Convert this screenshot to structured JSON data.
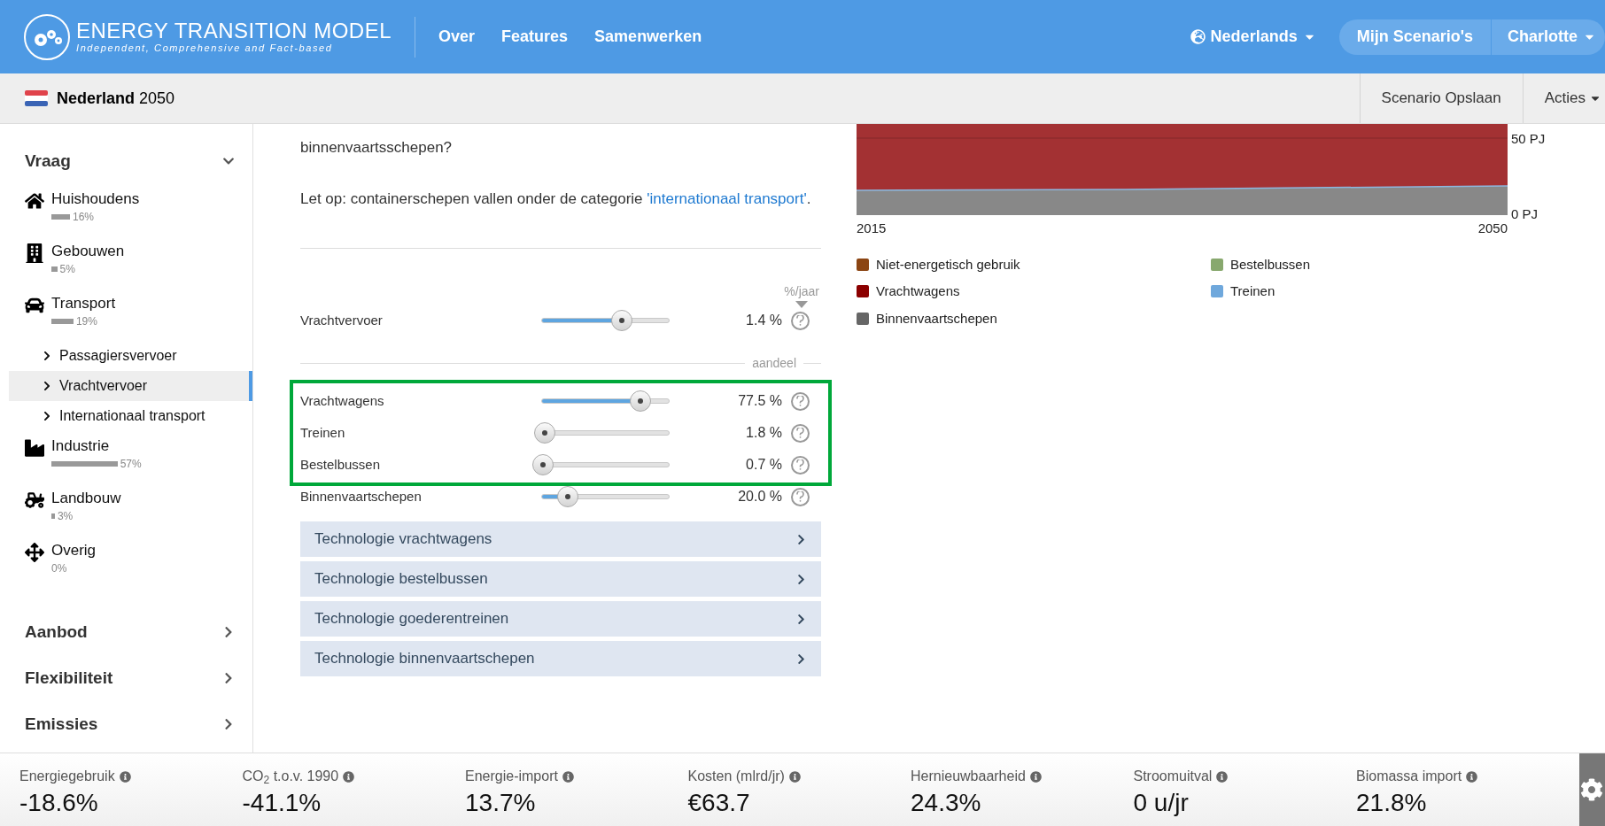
{
  "header": {
    "logo_title": "ENERGY TRANSITION MODEL",
    "logo_tagline": "Independent, Comprehensive and Fact-based",
    "nav": [
      "Over",
      "Features",
      "Samenwerken"
    ],
    "language": "Nederlands",
    "my_scenarios": "Mijn Scenario's",
    "user": "Charlotte"
  },
  "scenario_bar": {
    "title": "**Nederland** 2050",
    "save": "Scenario Opslaan",
    "actions": "Acties"
  },
  "sidebar": {
    "sections": [
      {
        "label": "Vraag",
        "expanded": true,
        "items": [
          {
            "label": "Huishoudens",
            "share": "16%"
          },
          {
            "label": "Gebouwen",
            "share": "5%"
          },
          {
            "label": "Transport",
            "share": "19%",
            "children": [
              {
                "label": "Passagiersvervoer",
                "selected": false
              },
              {
                "label": "Vrachtvervoer",
                "selected": true
              },
              {
                "label": "Internationaal transport",
                "selected": false
              }
            ]
          },
          {
            "label": "Industrie",
            "share": "57%"
          },
          {
            "label": "Landbouw",
            "share": "3%"
          },
          {
            "label": "Overig",
            "share": "0%"
          }
        ]
      },
      {
        "label": "Aanbod",
        "expanded": false
      },
      {
        "label": "Flexibiliteit",
        "expanded": false
      },
      {
        "label": "Emissies",
        "expanded": false
      }
    ]
  },
  "content": {
    "question_tail": "binnenvaartsschepen?",
    "note": "Let op: containerschepen vallen onder de categorie ",
    "note_link": "'internationaal transport'",
    "note_end": ".",
    "unit_label": "%/jaar",
    "share_label": "aandeel",
    "growth_slider": {
      "label": "Vrachtvervoer",
      "level": 0.63,
      "reading": "1.4 %"
    },
    "share_groups": [
      {
        "highlighted": true,
        "rows": [
          {
            "label": "Vrachtwagens",
            "level": 0.775,
            "reading": "77.5 %"
          },
          {
            "label": "Treinen",
            "level": 0.018,
            "reading": "1.8 %"
          },
          {
            "label": "Bestelbussen",
            "level": 0.007,
            "reading": "0.7 %"
          }
        ]
      },
      {
        "highlighted": false,
        "rows": [
          {
            "label": "Binnenvaartschepen",
            "level": 0.2,
            "reading": "20.0 %"
          }
        ]
      }
    ],
    "accordions": [
      "Technologie vrachtwagens",
      "Technologie bestelbussen",
      "Technologie goederentreinen",
      "Technologie binnenvaartschepen"
    ]
  },
  "chart": {
    "y_ticks": [
      "50 PJ",
      "0 PJ"
    ],
    "x_ticks": [
      "2015",
      "2050"
    ],
    "legend": [
      {
        "label": "Niet-energetisch gebruik",
        "color": "#8b4513"
      },
      {
        "label": "Bestelbussen",
        "color": "#88a86e"
      },
      {
        "label": "Vrachtwagens",
        "color": "#8b0000"
      },
      {
        "label": "Treinen",
        "color": "#6fa8dc"
      },
      {
        "label": "Binnenvaartschepen",
        "color": "#666666"
      }
    ]
  },
  "dashboard": [
    {
      "label": "Energiegebruik",
      "value": "-18.6%"
    },
    {
      "label": "CO$_{2}$ t.o.v. 1990",
      "value": "-41.1%"
    },
    {
      "label": "Energie-import",
      "value": "13.7%"
    },
    {
      "label": "Kosten (mlrd/jr)",
      "value": "€63.7"
    },
    {
      "label": "Hernieuwbaarheid",
      "value": "24.3%"
    },
    {
      "label": "Stroomuitval",
      "value": "0 u/jr"
    },
    {
      "label": "Biomassa import",
      "value": "21.8%"
    }
  ]
}
